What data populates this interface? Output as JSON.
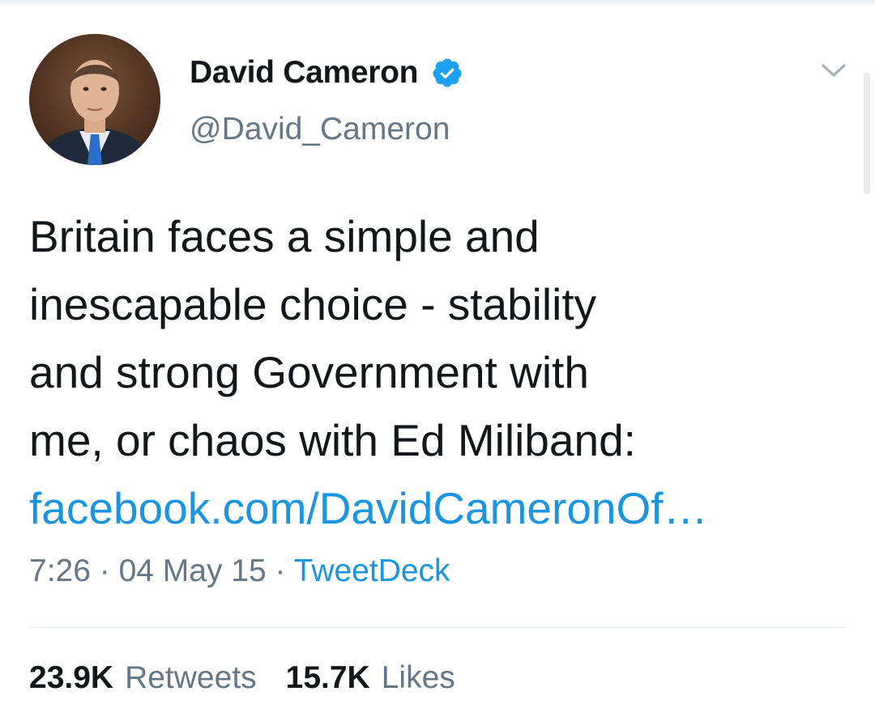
{
  "tweet": {
    "author": {
      "display_name": "David Cameron",
      "handle": "@David_Cameron",
      "verified": true
    },
    "text_lines": [
      "Britain faces a simple and",
      "inescapable choice - stability",
      "and strong Government with",
      "me, or chaos with Ed Miliband:"
    ],
    "link_text": "facebook.com/DavidCameronOf…",
    "time": "7:26",
    "date": "04 May 15",
    "separator": "·",
    "source": "TweetDeck",
    "retweets": {
      "count": "23.9K",
      "label": "Retweets"
    },
    "likes": {
      "count": "15.7K",
      "label": "Likes"
    }
  },
  "icons": {
    "verified": "verified-badge-icon",
    "menu": "chevron-down-icon"
  },
  "colors": {
    "link": "#1b95e0",
    "verified": "#1da1f2",
    "secondary_text": "#657786",
    "primary_text": "#14171a",
    "divider": "#e1e8ed"
  }
}
